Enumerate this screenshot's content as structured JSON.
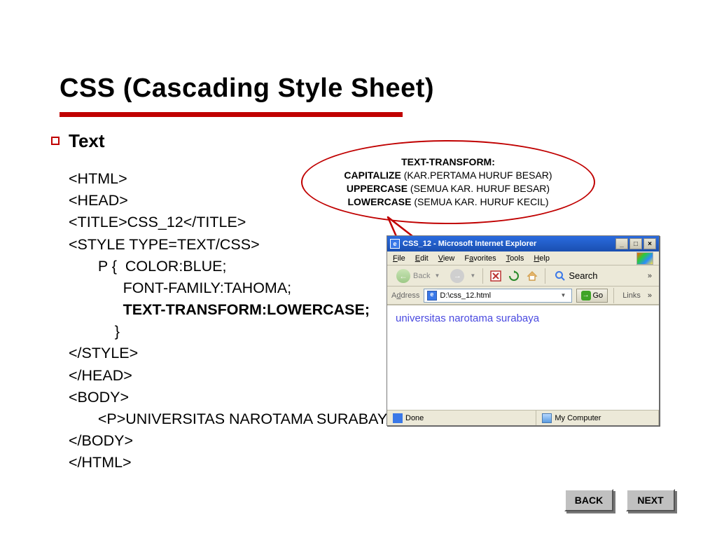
{
  "title": "CSS (Cascading Style Sheet)",
  "subtitle": "Text",
  "code": {
    "l1": "<HTML>",
    "l2": "<HEAD>",
    "l3": "<TITLE>CSS_12</TITLE>",
    "l4": "<STYLE TYPE=TEXT/CSS>",
    "l5": "       P {  COLOR:BLUE;",
    "l6": "             FONT-FAMILY:TAHOMA;",
    "l7_bold": "             TEXT-TRANSFORM:LOWERCASE;",
    "l8": "           }",
    "l9": "</STYLE>",
    "l10": "</HEAD>",
    "l11": "<BODY>",
    "l12": "       <P>UNIVERSITAS NAROTAMA SURABAYA</P>",
    "l13": "</BODY>",
    "l14": "</HTML>"
  },
  "bubble": {
    "line1_bold": "TEXT-TRANSFORM:",
    "line2_bold": "CAPITALIZE",
    "line2_rest": " (KAR.PERTAMA HURUF BESAR)",
    "line3_bold": "UPPERCASE",
    "line3_rest": " (SEMUA KAR. HURUF BESAR)",
    "line4_bold": "LOWERCASE",
    "line4_rest": " (SEMUA KAR. HURUF KECIL)"
  },
  "ie": {
    "title": "CSS_12 - Microsoft Internet Explorer",
    "menu": {
      "file": "File",
      "edit": "Edit",
      "view": "View",
      "favorites": "Favorites",
      "tools": "Tools",
      "help": "Help"
    },
    "toolbar": {
      "back": "Back",
      "search": "Search"
    },
    "address": {
      "label": "Address",
      "value": "D:\\css_12.html",
      "go": "Go",
      "links": "Links"
    },
    "content": "universitas narotama surabaya",
    "status": {
      "done": "Done",
      "zone": "My Computer"
    }
  },
  "nav": {
    "back": "BACK",
    "next": "NEXT"
  }
}
